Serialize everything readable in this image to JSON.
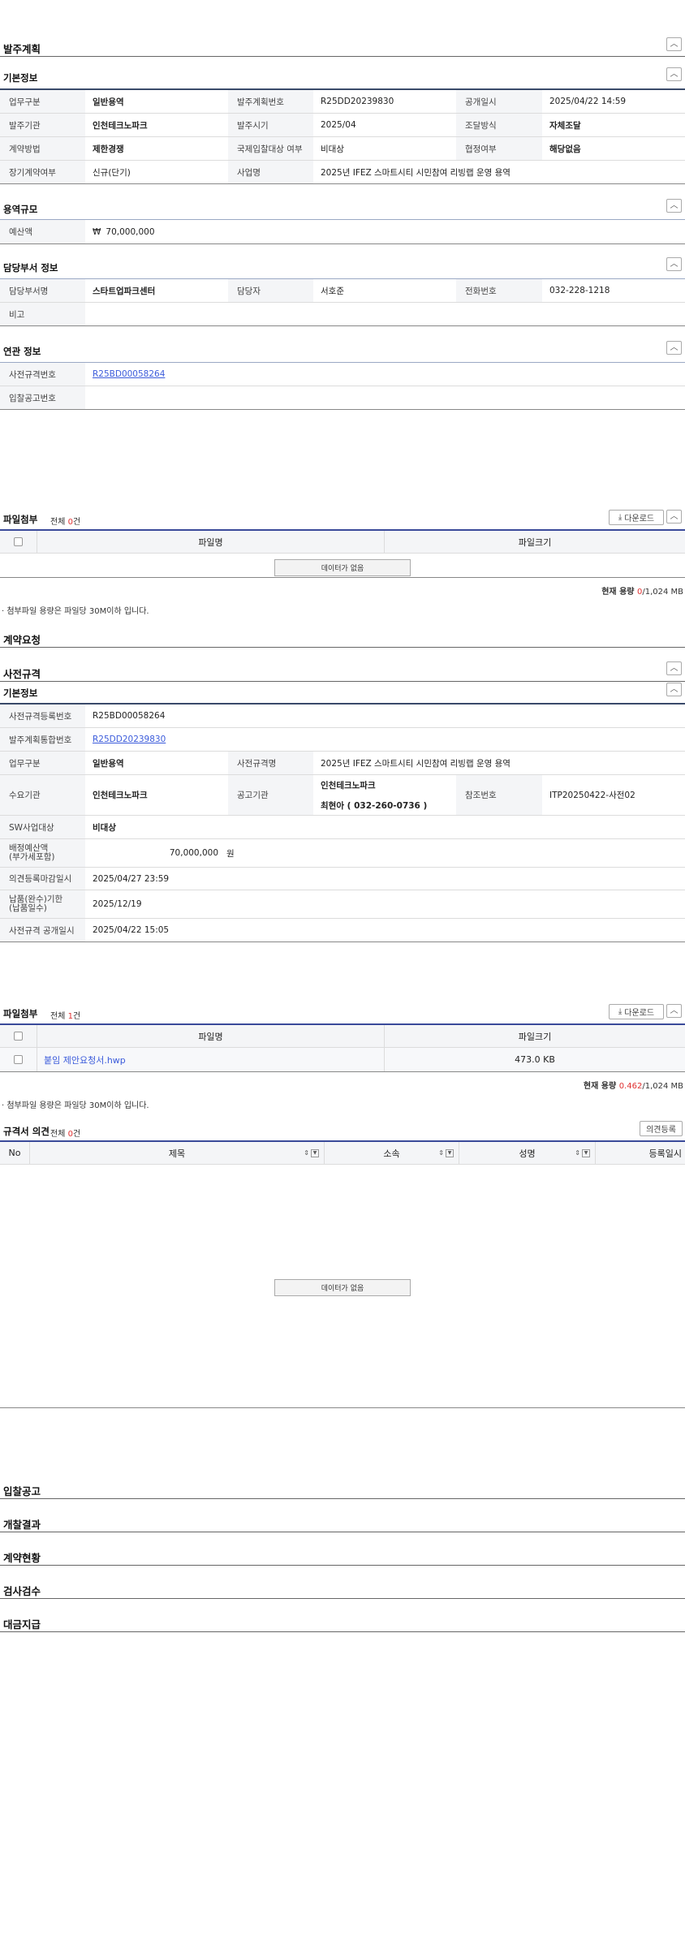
{
  "plan": {
    "title": "발주계획",
    "basic": {
      "title": "기본정보",
      "rows": [
        [
          {
            "h": "업무구분",
            "v": "일반용역",
            "bold": true
          },
          {
            "h": "발주계획번호",
            "v": "R25DD20239830"
          },
          {
            "h": "공개일시",
            "v": "2025/04/22 14:59"
          }
        ],
        [
          {
            "h": "발주기관",
            "v": "인천테크노파크",
            "bold": true
          },
          {
            "h": "발주시기",
            "v": "2025/04"
          },
          {
            "h": "조달방식",
            "v": "자체조달",
            "bold": true
          }
        ],
        [
          {
            "h": "계약방법",
            "v": "제한경쟁",
            "bold": true
          },
          {
            "h": "국제입찰대상 여부",
            "v": "비대상"
          },
          {
            "h": "협정여부",
            "v": "해당없음",
            "bold": true
          }
        ]
      ],
      "row4": {
        "h1": "장기계약여부",
        "v1": "신규(단기)",
        "h2": "사업명",
        "v2": "2025년 IFEZ 스마트시티 시민참여 리빙랩 운영 용역"
      }
    },
    "scale": {
      "title": "용역규모",
      "h": "예산액",
      "currency": "₩",
      "v": "70,000,000"
    },
    "dept": {
      "title": "담당부서 정보",
      "h1": "담당부서명",
      "v1": "스타트업파크센터",
      "h2": "담당자",
      "v2": "서호준",
      "h3": "전화번호",
      "v3": "032-228-1218",
      "h4": "비고",
      "v4": ""
    },
    "related": {
      "title": "연관 정보",
      "h1": "사전규격번호",
      "v1": "R25BD00058264",
      "h2": "입찰공고번호",
      "v2": ""
    }
  },
  "files1": {
    "title": "파일첨부",
    "total_prefix": "전체 ",
    "total": "0",
    "total_suffix": "건",
    "download": "다운로드",
    "col_name": "파일명",
    "col_size": "파일크기",
    "nodata": "데이터가 없음",
    "usage_label": "현재 용량 ",
    "usage_used": "0",
    "usage_sep": "/",
    "usage_max": "1,024 MB",
    "note": "첨부파일 용량은 파일당 30M이하 입니다."
  },
  "contract_req": {
    "title": "계약요청"
  },
  "pre": {
    "title": "사전규격",
    "basic_title": "기본정보",
    "reg_no_h": "사전규격등록번호",
    "reg_no": "R25BD00058264",
    "plan_no_h": "발주계획통합번호",
    "plan_no": "R25DD20239830",
    "task_h": "업무구분",
    "task": "일반용역",
    "name_h": "사전규격명",
    "name": "2025년 IFEZ 스마트시티 시민참여 리빙랩 운영 용역",
    "demand_h": "수요기관",
    "demand": "인천테크노파크",
    "notice_h": "공고기관",
    "notice_org": "인천테크노파크",
    "notice_person": "최현아 ( 032-260-0736 )",
    "ref_h": "참조번호",
    "ref": "ITP20250422-사전02",
    "sw_h": "SW사업대상",
    "sw": "비대상",
    "budget_h1": "배정예산액",
    "budget_h2": "(부가세포함)",
    "budget": "70,000,000",
    "budget_unit": "원",
    "deadline_h": "의견등록마감일시",
    "deadline": "2025/04/27 23:59",
    "delivery_h1": "납품(완수)기한",
    "delivery_h2": "(납품일수)",
    "delivery": "2025/12/19",
    "open_h": "사전규격 공개일시",
    "open": "2025/04/22 15:05"
  },
  "files2": {
    "title": "파일첨부",
    "total_prefix": "전체 ",
    "total": "1",
    "total_suffix": "건",
    "download": "다운로드",
    "col_name": "파일명",
    "col_size": "파일크기",
    "file_name": "붙임 제안요청서.hwp",
    "file_size": "473.0 KB",
    "usage_label": "현재 용량 ",
    "usage_used": "0.462",
    "usage_sep": "/",
    "usage_max": "1,024 MB",
    "note": "첨부파일 용량은 파일당 30M이하 입니다."
  },
  "opinion": {
    "title": "규격서 의견",
    "total_prefix": "전체 ",
    "total": "0",
    "total_suffix": "건",
    "register": "의견등록",
    "cols": [
      "No",
      "제목",
      "소속",
      "성명",
      "등록일시"
    ],
    "nodata": "데이터가 없음"
  },
  "bottom_sections": [
    "입찰공고",
    "개찰결과",
    "계약현황",
    "검사검수",
    "대금지급"
  ]
}
